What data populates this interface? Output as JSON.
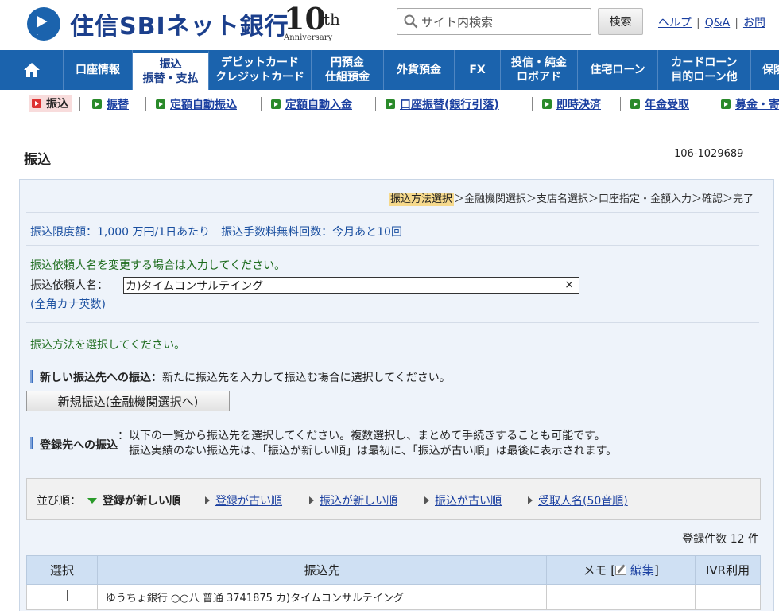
{
  "header": {
    "brand": "住信SBIネット銀行",
    "anniversary_num": "10",
    "anniversary_th": "th",
    "anniversary_word": "Anniversary",
    "search_placeholder": "サイト内検索",
    "search_button": "検索",
    "links": [
      "ヘルプ",
      "Q&A",
      "お問"
    ]
  },
  "gnav": {
    "items": [
      {
        "label": "口座情報"
      },
      {
        "label1": "振込",
        "label2": "振替・支払"
      },
      {
        "label1": "デビットカード",
        "label2": "クレジットカード"
      },
      {
        "label1": "円預金",
        "label2": "仕組預金"
      },
      {
        "label": "外貨預金"
      },
      {
        "label": "FX"
      },
      {
        "label1": "投信・純金",
        "label2": "ロボアド"
      },
      {
        "label": "住宅ローン"
      },
      {
        "label1": "カードローン",
        "label2": "目的ローン他"
      },
      {
        "label": "保険"
      }
    ]
  },
  "subnav": {
    "items": [
      "振込",
      "振替",
      "定額自動振込",
      "定額自動入金",
      "口座振替(銀行引落)",
      "即時決済",
      "年金受取",
      "募金・寄"
    ]
  },
  "page": {
    "title": "振込",
    "user_id": "106-1029689",
    "steps_current": "振込方法選択",
    "steps_rest": "＞金融機関選択＞支店名選択＞口座指定・金額入力＞確認＞完了",
    "limit_text": "振込限度額：1,000 万円/1日あたり　振込手数料無料回数：今月あと10回",
    "name_change_note": "振込依頼人名を変更する場合は入力してください。",
    "name_label": "振込依頼人名：",
    "name_value": "カ)タイムコンサルテイング",
    "kana_note": "(全角カナ英数)",
    "method_note": "振込方法を選択してください。",
    "new_transfer_title": "新しい振込先への振込",
    "new_transfer_desc": "：新たに振込先を入力して振込む場合に選択してください。",
    "new_transfer_button": "新規振込(金融機関選択へ)",
    "registered_title": "登録先への振込",
    "registered_desc1": "：以下の一覧から振込先を選択してください。複数選択し、まとめて手続きすることも可能です。",
    "registered_desc2": "振込実績のない振込先は、「振込が新しい順」は最初に、「振込が古い順」は最後に表示されます。",
    "sort_label": "並び順：",
    "sort_options": [
      "登録が新しい順",
      "登録が古い順",
      "振込が新しい順",
      "振込が古い順",
      "受取人名(50音順)"
    ],
    "count_text": "登録件数 12 件",
    "table": {
      "headers": [
        "選択",
        "振込先",
        "メモ [",
        "編集",
        "]",
        "IVR利用"
      ],
      "rows": [
        {
          "payee": "ゆうちょ銀行 ○○八 普通 3741875 カ)タイムコンサルテイング",
          "memo": "",
          "ivr": ""
        }
      ]
    }
  },
  "colors": {
    "nav_blue": "#1b63ad",
    "link_blue": "#1a3fa0",
    "green_note": "#1c6b1c",
    "step_highlight": "#f6d98c"
  }
}
